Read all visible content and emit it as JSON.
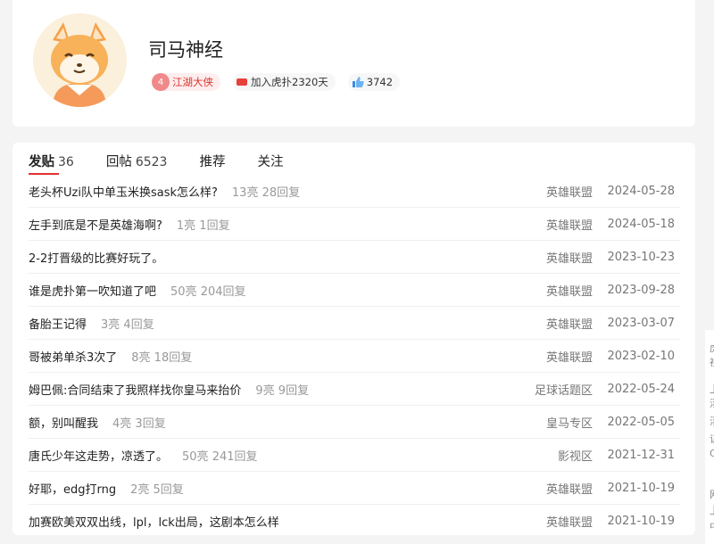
{
  "profile": {
    "username": "司马神经",
    "level_num": "4",
    "level_title": "江湖大侠",
    "join_text": "加入虎扑2320天",
    "likes": "3742"
  },
  "tabs": [
    {
      "label": "发贴",
      "count": "36",
      "active": true
    },
    {
      "label": "回帖",
      "count": "6523"
    },
    {
      "label": "推荐",
      "count": ""
    },
    {
      "label": "关注",
      "count": ""
    }
  ],
  "posts": [
    {
      "title": "老头杯Uzi队中单玉米换sask怎么样?",
      "stats": "13亮 28回复",
      "forum": "英雄联盟",
      "date": "2024-05-28"
    },
    {
      "title": "左手到底是不是英雄海啊?",
      "stats": "1亮 1回复",
      "forum": "英雄联盟",
      "date": "2024-05-18"
    },
    {
      "title": "2-2打晋级的比赛好玩了。",
      "stats": "",
      "forum": "英雄联盟",
      "date": "2023-10-23"
    },
    {
      "title": "谁是虎扑第一吹知道了吧",
      "stats": "50亮 204回复",
      "forum": "英雄联盟",
      "date": "2023-09-28"
    },
    {
      "title": "备胎王记得",
      "stats": "3亮 4回复",
      "forum": "英雄联盟",
      "date": "2023-03-07"
    },
    {
      "title": "哥被弟单杀3次了",
      "stats": "8亮 18回复",
      "forum": "英雄联盟",
      "date": "2023-02-10"
    },
    {
      "title": "姆巴佩:合同结束了我照样找你皇马来抬价",
      "stats": "9亮 9回复",
      "forum": "足球话题区",
      "date": "2022-05-24"
    },
    {
      "title": "额，别叫醒我",
      "stats": "4亮 3回复",
      "forum": "皇马专区",
      "date": "2022-05-05"
    },
    {
      "title": "唐氏少年这走势，凉透了。",
      "stats": "50亮 241回复",
      "forum": "影视区",
      "date": "2021-12-31"
    },
    {
      "title": "好耶，edg打rng",
      "stats": "2亮 5回复",
      "forum": "英雄联盟",
      "date": "2021-10-19"
    },
    {
      "title": "加赛欧美双双出线，lpl，lck出局，这剧本怎么样",
      "stats": "",
      "forum": "英雄联盟",
      "date": "2021-10-19"
    }
  ],
  "side": {
    "chars": [
      "虎",
      "社",
      "上",
      "汤",
      "汤",
      "证",
      "C",
      "",
      "网",
      "上",
      "中"
    ]
  }
}
